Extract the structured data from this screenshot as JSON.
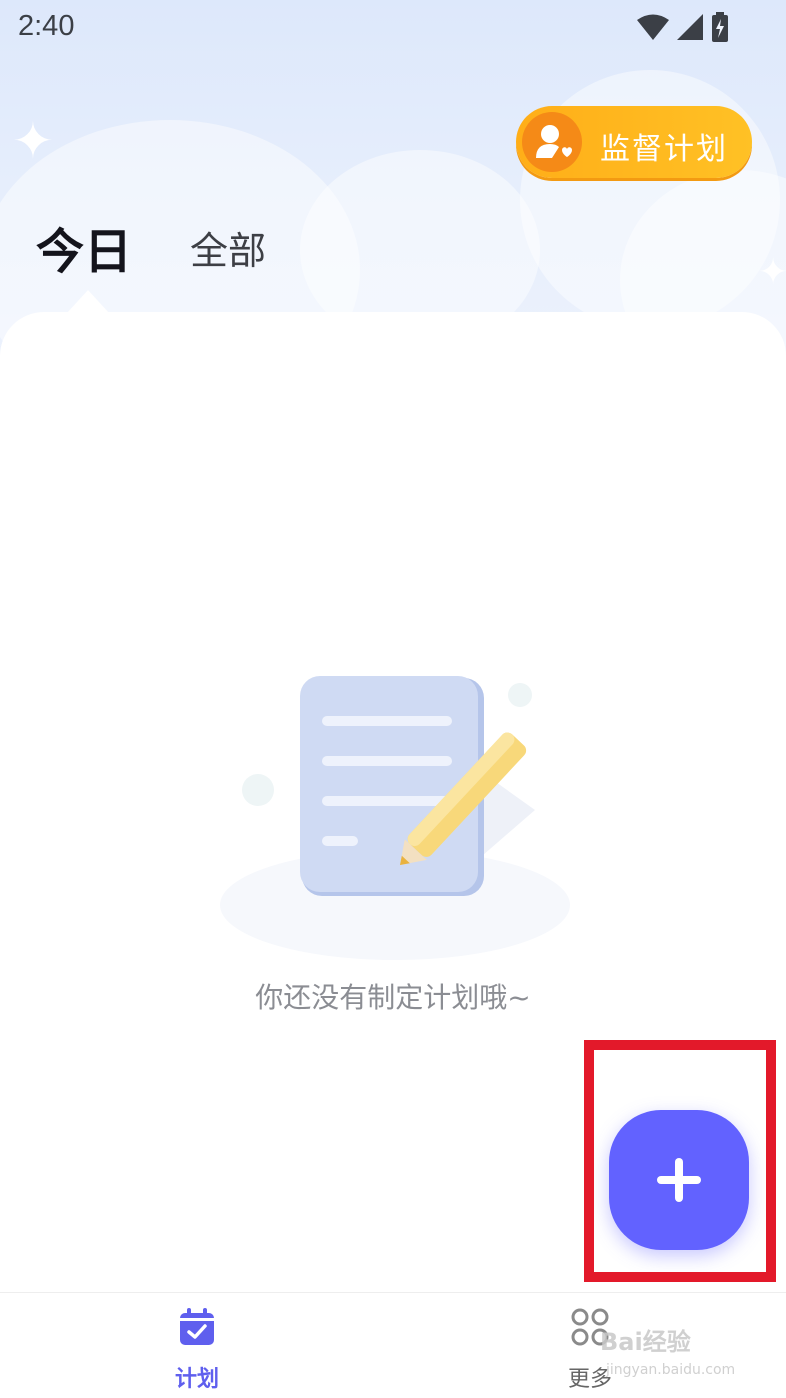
{
  "status_bar": {
    "time": "2:40",
    "icons": [
      "wifi-icon",
      "signal-icon",
      "battery-charging-icon"
    ]
  },
  "header": {
    "supervise_button_label": "监督计划",
    "tabs": [
      {
        "label": "今日",
        "active": true
      },
      {
        "label": "全部",
        "active": false
      }
    ]
  },
  "main": {
    "empty_state_text": "你还没有制定计划哦~",
    "empty_state_icon": "document-pencil-illustration"
  },
  "fab": {
    "icon": "plus-icon",
    "highlighted": true
  },
  "bottom_nav": {
    "items": [
      {
        "label": "计划",
        "icon": "calendar-check-icon",
        "active": true
      },
      {
        "label": "更多",
        "icon": "grid-icon",
        "active": false
      }
    ]
  },
  "watermark": {
    "brand": "Bai经验",
    "url": "jingyan.baidu.com"
  },
  "colors": {
    "accent": "#6262ff",
    "supervise_gradient_start": "#ffae18",
    "supervise_gradient_end": "#ffc125",
    "highlight_box": "#e3192a"
  }
}
